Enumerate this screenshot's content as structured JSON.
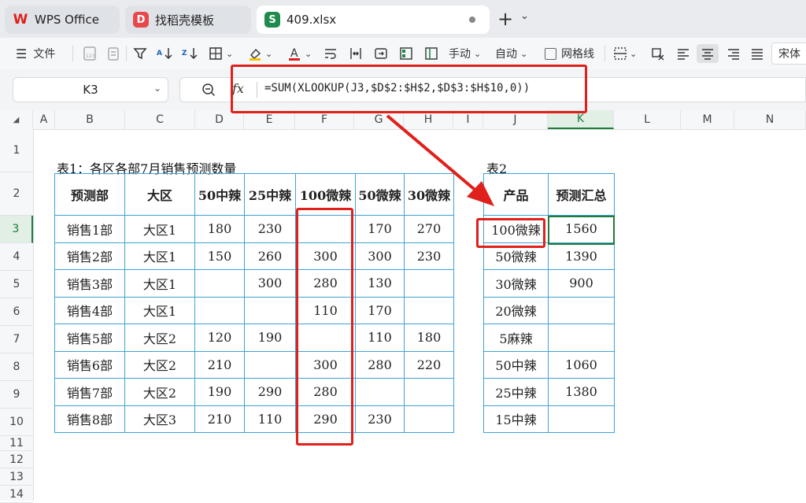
{
  "tabs": [
    {
      "label": "WPS Office",
      "icon": "wps-logo-icon",
      "color": "#e0201b"
    },
    {
      "label": "找稻壳模板",
      "icon": "docer-icon",
      "color": "#e8474b"
    },
    {
      "label": "409.xlsx",
      "icon": "spreadsheet-icon",
      "color": "#1f8a4c",
      "active": true
    }
  ],
  "toolbar": {
    "file_label": "文件",
    "manual_label": "手动",
    "auto_label": "自动",
    "gridlines_label": "网格线",
    "font_label": "宋体",
    "fill_color": "#f2c200",
    "font_color": "#e0201b"
  },
  "formula_bar": {
    "cell_ref": "K3",
    "fx": "fx",
    "formula": "=SUM(XLOOKUP(J3,$D$2:$H$2,$D$3:$H$10,0))"
  },
  "columns": [
    "A",
    "B",
    "C",
    "D",
    "E",
    "F",
    "G",
    "H",
    "I",
    "J",
    "K",
    "L",
    "M",
    "N"
  ],
  "rows": [
    "1",
    "2",
    "3",
    "4",
    "5",
    "6",
    "7",
    "8",
    "9",
    "10",
    "11",
    "12",
    "13",
    "14"
  ],
  "selected_cell": {
    "col": "K",
    "row": "3"
  },
  "table1": {
    "caption": "表1：各区各部7月销售预测数量",
    "headers": [
      "预测部",
      "大区",
      "50中辣",
      "25中辣",
      "100微辣",
      "50微辣",
      "30微辣"
    ],
    "rows": [
      [
        "销售1部",
        "大区1",
        "180",
        "230",
        "",
        "170",
        "270"
      ],
      [
        "销售2部",
        "大区1",
        "150",
        "260",
        "300",
        "300",
        "230"
      ],
      [
        "销售3部",
        "大区1",
        "",
        "300",
        "280",
        "130",
        ""
      ],
      [
        "销售4部",
        "大区1",
        "",
        "",
        "110",
        "170",
        ""
      ],
      [
        "销售5部",
        "大区2",
        "120",
        "190",
        "",
        "110",
        "180"
      ],
      [
        "销售6部",
        "大区2",
        "210",
        "",
        "300",
        "280",
        "220"
      ],
      [
        "销售7部",
        "大区2",
        "190",
        "290",
        "280",
        "",
        ""
      ],
      [
        "销售8部",
        "大区3",
        "210",
        "110",
        "290",
        "230",
        ""
      ]
    ]
  },
  "table2": {
    "caption": "表2",
    "headers": [
      "产品",
      "预测汇总"
    ],
    "rows": [
      [
        "100微辣",
        "1560"
      ],
      [
        "50微辣",
        "1390"
      ],
      [
        "30微辣",
        "900"
      ],
      [
        "20微辣",
        ""
      ],
      [
        "5麻辣",
        ""
      ],
      [
        "50中辣",
        "1060"
      ],
      [
        "25中辣",
        "1380"
      ],
      [
        "15中辣",
        ""
      ]
    ]
  },
  "annotation_color": "#e0201b"
}
